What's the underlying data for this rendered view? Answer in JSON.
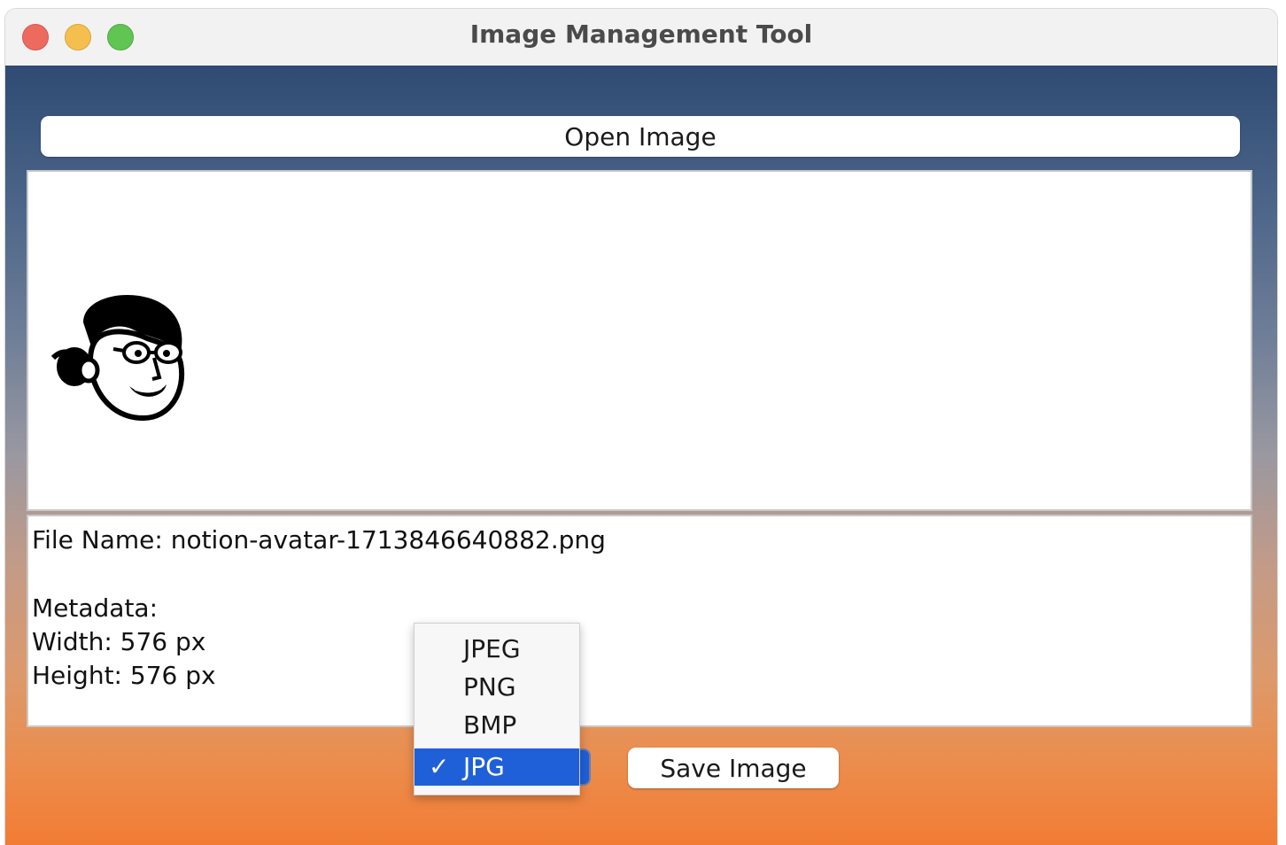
{
  "window": {
    "title": "Image Management Tool"
  },
  "toolbar": {
    "open_label": "Open Image",
    "save_label": "Save Image"
  },
  "preview": {
    "image_icon": "avatar-face-icon"
  },
  "info": {
    "file_name": "File Name: notion-avatar-1713846640882.png",
    "metadata_header": "Metadata:",
    "width": "Width: 576 px",
    "height": "Height: 576 px"
  },
  "format_menu": {
    "options": [
      "JPEG",
      "PNG",
      "BMP",
      "JPG"
    ],
    "selected": "JPG",
    "check_glyph": "✓"
  },
  "colors": {
    "selection": "#1f5fd8",
    "background_top": "#2f4b73",
    "background_bottom": "#f27c34"
  }
}
